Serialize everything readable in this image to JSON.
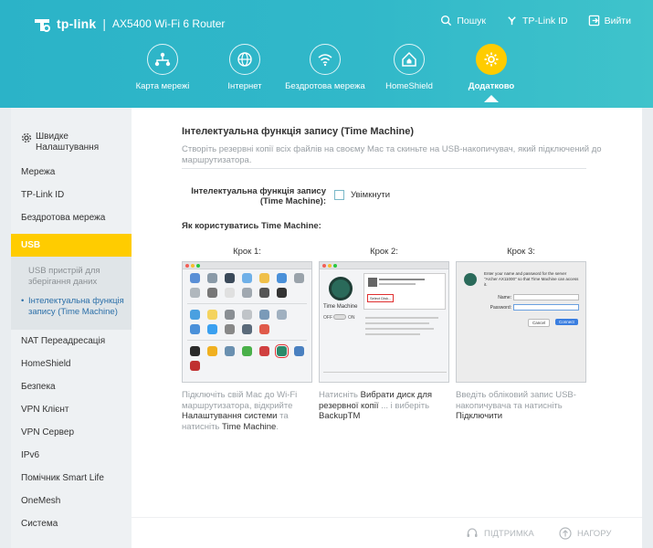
{
  "header": {
    "brand": "tp-link",
    "separator": "|",
    "model": "AX5400 Wi-Fi 6 Router",
    "links": {
      "search": "Пошук",
      "tplink_id": "TP-Link ID",
      "logout": "Вийти"
    },
    "accent": "#ffcc00"
  },
  "nav": {
    "items": [
      {
        "label": "Карта мережі",
        "icon": "network-map-icon"
      },
      {
        "label": "Інтернет",
        "icon": "globe-icon"
      },
      {
        "label": "Бездротова мережа",
        "icon": "wifi-icon"
      },
      {
        "label": "HomeShield",
        "icon": "home-shield-icon"
      },
      {
        "label": "Додатково",
        "icon": "gear-icon",
        "active": true
      }
    ]
  },
  "sidebar": {
    "quick_setup": "Швидке Налаштування",
    "items": [
      "Мережа",
      "TP-Link ID",
      "Бездротова мережа",
      "USB",
      "NAT Переадресація",
      "HomeShield",
      "Безпека",
      "VPN Клієнт",
      "VPN Сервер",
      "IPv6",
      "Помічник Smart Life",
      "OneMesh",
      "Система"
    ],
    "usb_sub": [
      "USB пристрій для зберігання даних",
      "Інтелектуальна функція запису (Time Machine)"
    ]
  },
  "main": {
    "title": "Інтелектуальна функція запису (Time Machine)",
    "description": "Створіть резервні копії всіх файлів на своєму Mac та скиньте на USB-накопичувач, який підключений до маршрутизатора.",
    "tm_label": "Інтелектуальна функція запису (Time Machine):",
    "tm_checkbox_label": "Увімкнути",
    "tm_enabled": false,
    "how_title": "Як користуватись Time Machine:",
    "steps": [
      {
        "title": "Крок 1:",
        "desc_1": "Підключіть свій Mac до Wi-Fi маршрутизатора, відкрийте ",
        "desc_bold_1": "Налаштування системи",
        "desc_2": " та натисніть ",
        "desc_bold_2": "Time Machine",
        "desc_3": "."
      },
      {
        "title": "Крок 2:",
        "desc_1": "Натисніть ",
        "desc_bold_1": "Вибрати диск для резервної копії",
        "desc_2": " ... і виберіть ",
        "desc_bold_2": "BackupTM",
        "desc_3": ""
      },
      {
        "title": "Крок 3:",
        "desc_1": "Введіть обліковий запис USB-накопичувача та натисніть ",
        "desc_bold_1": "Підключити",
        "desc_2": "",
        "desc_bold_2": "",
        "desc_3": ""
      }
    ],
    "step2_img": {
      "title": "Time Machine",
      "off": "OFF",
      "on": "ON",
      "button": "Select Disk..."
    },
    "step3_img": {
      "prompt": "Enter your name and password for the server \"Archer AX11000\" so that Time Machine can access it.",
      "name_label": "Name:",
      "password_label": "Password:",
      "cancel": "Cancel",
      "connect": "Connect"
    }
  },
  "footer": {
    "support": "ПІДТРИМКА",
    "back_to_top": "НАГОРУ"
  }
}
